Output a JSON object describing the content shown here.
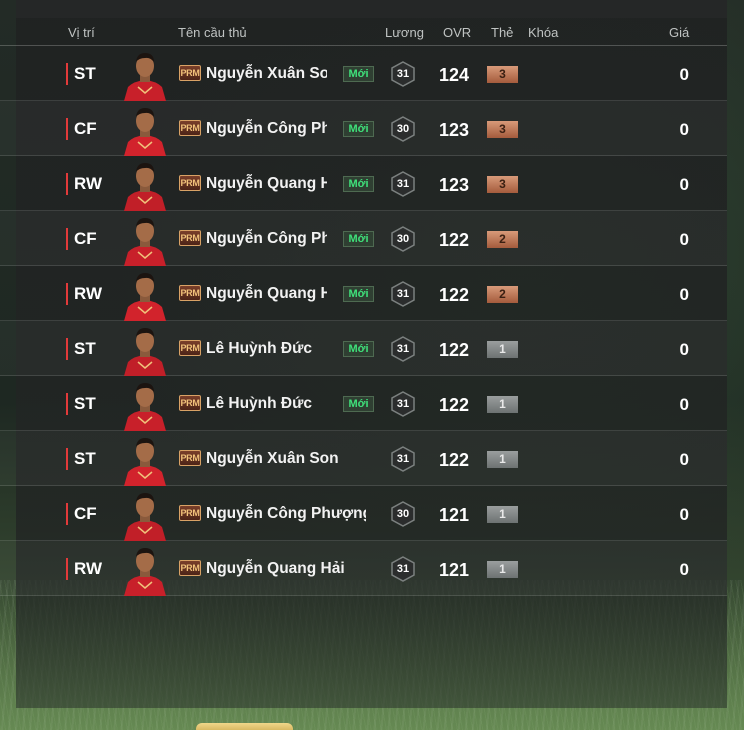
{
  "header": {
    "position": "Vị trí",
    "player_name": "Tên cầu thủ",
    "salary": "Lương",
    "ovr": "OVR",
    "card": "Thẻ",
    "lock": "Khóa",
    "price": "Giá"
  },
  "badge_prm": "PRM",
  "colors": {
    "position_accent": "#e23a3a",
    "new_badge_text": "#3fe07a",
    "grade_bronze": "#c57a55",
    "grade_grey": "#858a8a"
  },
  "rows": [
    {
      "pos": "ST",
      "name": "Nguyễn Xuân Son",
      "new": "Mới",
      "salary": "31",
      "ovr": "124",
      "grade": "3",
      "price": "0"
    },
    {
      "pos": "CF",
      "name": "Nguyễn Công Phượng",
      "new": "Mới",
      "salary": "30",
      "ovr": "123",
      "grade": "3",
      "price": "0"
    },
    {
      "pos": "RW",
      "name": "Nguyễn Quang Hải",
      "new": "Mới",
      "salary": "31",
      "ovr": "123",
      "grade": "3",
      "price": "0"
    },
    {
      "pos": "CF",
      "name": "Nguyễn Công Phượng",
      "new": "Mới",
      "salary": "30",
      "ovr": "122",
      "grade": "2",
      "price": "0"
    },
    {
      "pos": "RW",
      "name": "Nguyễn Quang Hải",
      "new": "Mới",
      "salary": "31",
      "ovr": "122",
      "grade": "2",
      "price": "0"
    },
    {
      "pos": "ST",
      "name": "Lê Huỳnh Đức",
      "new": "Mới",
      "salary": "31",
      "ovr": "122",
      "grade": "1",
      "price": "0"
    },
    {
      "pos": "ST",
      "name": "Lê Huỳnh Đức",
      "new": "Mới",
      "salary": "31",
      "ovr": "122",
      "grade": "1",
      "price": "0"
    },
    {
      "pos": "ST",
      "name": "Nguyễn Xuân Son",
      "new": "",
      "salary": "31",
      "ovr": "122",
      "grade": "1",
      "price": "0"
    },
    {
      "pos": "CF",
      "name": "Nguyễn Công Phượng",
      "new": "",
      "salary": "30",
      "ovr": "121",
      "grade": "1",
      "price": "0"
    },
    {
      "pos": "RW",
      "name": "Nguyễn Quang Hải",
      "new": "",
      "salary": "31",
      "ovr": "121",
      "grade": "1",
      "price": "0"
    }
  ]
}
